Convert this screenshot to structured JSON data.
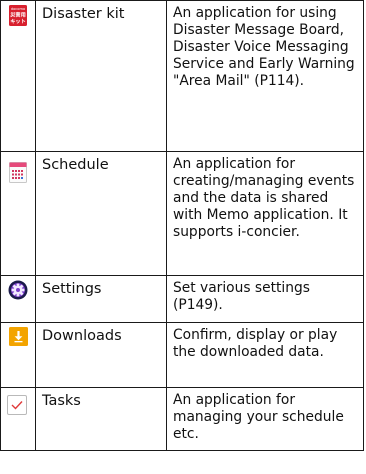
{
  "rows": [
    {
      "icon": "disaster-kit-icon",
      "icon_text": [
        "docomo",
        "災害用",
        "キット"
      ],
      "name": "Disaster kit",
      "description": "An application for using Disaster Message Board, Disaster Voice Messaging Service and Early Warning \"Area Mail\" (P114)."
    },
    {
      "icon": "calendar-icon",
      "name": "Schedule",
      "description": "An application for creating/managing events and the data is shared with Memo application. It supports i-concier."
    },
    {
      "icon": "gear-icon",
      "name": "Settings",
      "description": "Set various settings (P149)."
    },
    {
      "icon": "download-icon",
      "name": "Downloads",
      "description": "Confirm, display or play the downloaded data."
    },
    {
      "icon": "checkbox-icon",
      "name": "Tasks",
      "description": "An application for managing your schedule etc."
    }
  ],
  "colors": {
    "disaster_red": "#d8202e",
    "settings_purple": "#7a3ec9",
    "downloads_orange": "#f3a400",
    "tasks_check": "#e03a3a"
  }
}
